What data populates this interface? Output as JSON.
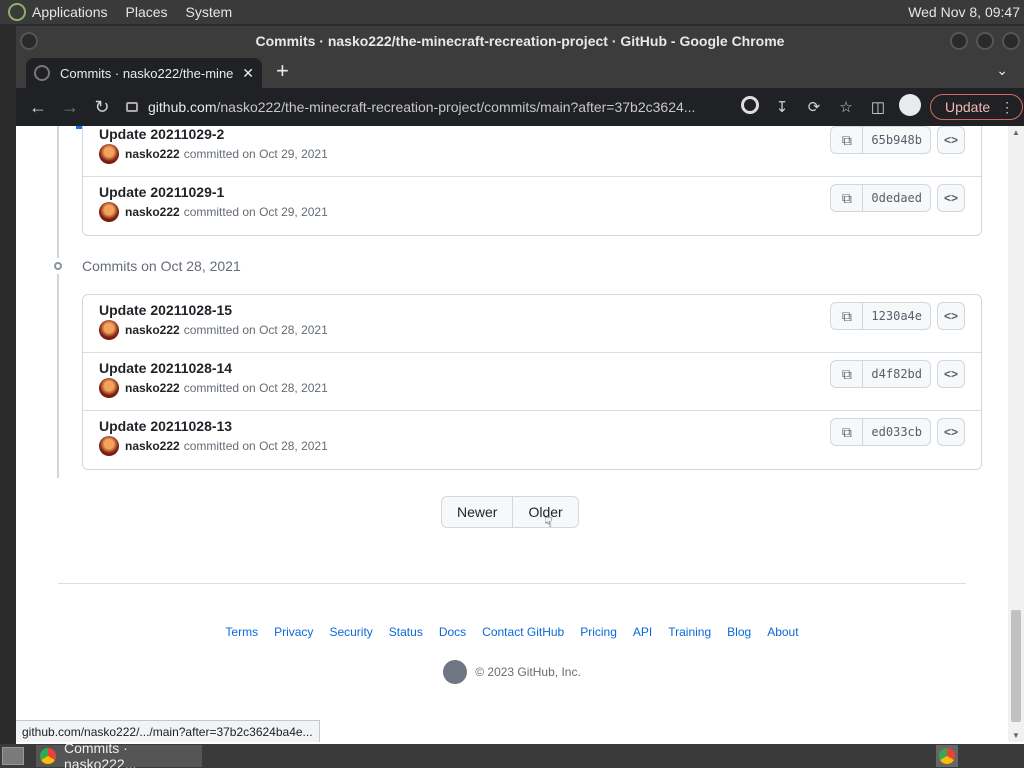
{
  "top_panel": {
    "menus": [
      "Applications",
      "Places",
      "System"
    ],
    "clock": "Wed Nov 8, 09:47"
  },
  "window": {
    "title": "Commits · nasko222/the-minecraft-recreation-project · GitHub - Google Chrome"
  },
  "tab": {
    "title": "Commits · nasko222/the-mine",
    "close": "✕",
    "new_tab": "+"
  },
  "toolbar": {
    "url_host": "github.com",
    "url_path": "/nasko222/the-minecraft-recreation-project/commits/main?after=37b2c3624...",
    "update_label": "Update"
  },
  "commit_groups": [
    {
      "heading": "",
      "commits": [
        {
          "message": "Update 20211029-2",
          "author": "nasko222",
          "date": "committed on Oct 29, 2021",
          "sha": "65b948b"
        },
        {
          "message": "Update 20211029-1",
          "author": "nasko222",
          "date": "committed on Oct 29, 2021",
          "sha": "0dedaed"
        }
      ]
    },
    {
      "heading": "Commits on Oct 28, 2021",
      "commits": [
        {
          "message": "Update 20211028-15",
          "author": "nasko222",
          "date": "committed on Oct 28, 2021",
          "sha": "1230a4e"
        },
        {
          "message": "Update 20211028-14",
          "author": "nasko222",
          "date": "committed on Oct 28, 2021",
          "sha": "d4f82bd"
        },
        {
          "message": "Update 20211028-13",
          "author": "nasko222",
          "date": "committed on Oct 28, 2021",
          "sha": "ed033cb"
        }
      ]
    }
  ],
  "pagination": {
    "newer": "Newer",
    "older": "Older"
  },
  "footer": {
    "links": [
      "Terms",
      "Privacy",
      "Security",
      "Status",
      "Docs",
      "Contact GitHub",
      "Pricing",
      "API",
      "Training",
      "Blog",
      "About"
    ],
    "copyright": "© 2023 GitHub, Inc."
  },
  "status_bar_url": "github.com/nasko222/.../main?after=37b2c3624ba4e...",
  "taskbar": {
    "task_label": "Commits · nasko222..."
  }
}
